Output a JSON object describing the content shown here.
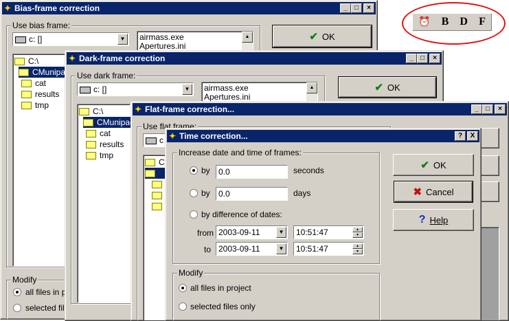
{
  "bias": {
    "title": "Bias-frame correction",
    "use_label": "Use bias frame:",
    "drive": "c: []",
    "files": [
      "airmass.exe",
      "Apertures.ini"
    ],
    "tree": [
      "C:\\",
      "CMunipac",
      "cat",
      "results",
      "tmp"
    ],
    "ok": "OK",
    "modify_label": "Modify",
    "opt_all": "all files in proj",
    "opt_selected": "selected files"
  },
  "dark": {
    "title": "Dark-frame correction",
    "use_label": "Use dark frame:",
    "drive": "c: []",
    "files": [
      "airmass.exe",
      "Apertures.ini"
    ],
    "tree": [
      "C:\\",
      "CMunipac",
      "cat",
      "results",
      "tmp"
    ],
    "ok": "OK"
  },
  "flat": {
    "title": "Flat-frame correction...",
    "use_label": "Use flat frame:",
    "drive": "c",
    "tree_root": "C"
  },
  "time": {
    "title": "Time correction...",
    "help_glyph": "?",
    "close_glyph": "X",
    "group_label": "Increase date and time of frames:",
    "by_label": "by",
    "seconds_value": "0.0",
    "seconds_unit": "seconds",
    "days_value": "0.0",
    "days_unit": "days",
    "diff_label": "by difference of dates:",
    "from_label": "from",
    "to_label": "to",
    "from_date": "2003-09-11",
    "from_time": "10:51:47",
    "to_date": "2003-09-11",
    "to_time": "10:51:47",
    "modify_label": "Modify",
    "opt_all": "all files in project",
    "opt_selected": "selected files only",
    "ok": "OK",
    "cancel": "Cancel",
    "help": "Help"
  },
  "toolbar": {
    "b": "B",
    "d": "D",
    "f": "F"
  }
}
